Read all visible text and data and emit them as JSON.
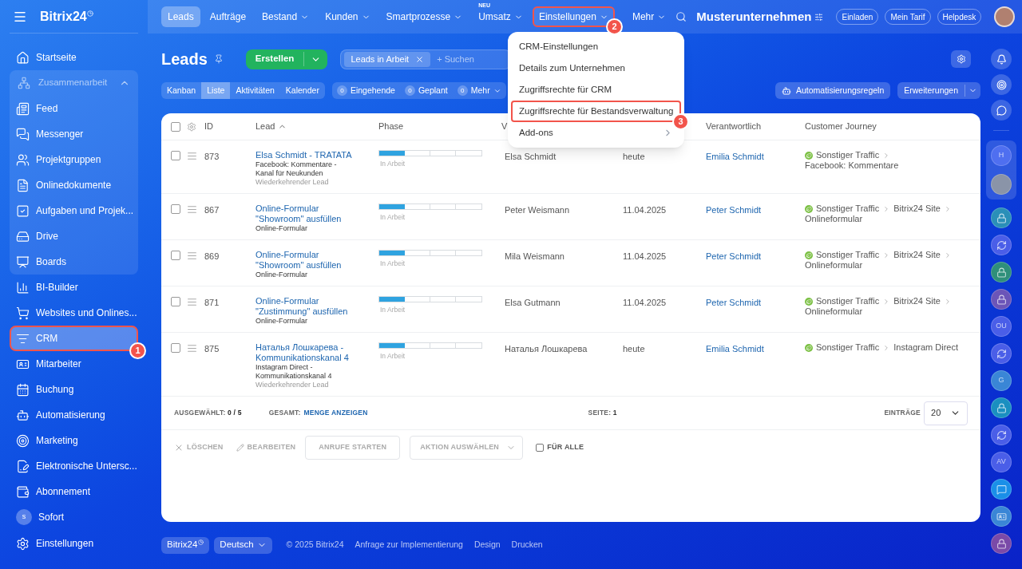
{
  "sidebar": {
    "logo": "Bitrix24",
    "items": [
      {
        "kind": "item",
        "label": "Startseite",
        "selected": false
      },
      {
        "kind": "group",
        "label": "Zusammenarbeit",
        "expanded": true,
        "children": [
          {
            "label": "Feed",
            "selected": false
          },
          {
            "label": "Messenger",
            "selected": false
          },
          {
            "label": "Projektgruppen",
            "selected": false
          },
          {
            "label": "Onlinedokumente",
            "selected": false
          },
          {
            "label": "Aufgaben und Projek...",
            "selected": false
          },
          {
            "label": "Drive",
            "selected": false
          },
          {
            "label": "Boards",
            "selected": false
          }
        ]
      },
      {
        "kind": "item",
        "label": "BI-Builder",
        "selected": false
      },
      {
        "kind": "item",
        "label": "Websites und Onlines...",
        "selected": false
      },
      {
        "kind": "item",
        "label": "CRM",
        "selected": true,
        "highlighted": true,
        "callout": "1"
      },
      {
        "kind": "item",
        "label": "Mitarbeiter",
        "selected": false
      },
      {
        "kind": "item",
        "label": "Buchung",
        "selected": false
      },
      {
        "kind": "item",
        "label": "Automatisierung",
        "selected": false
      },
      {
        "kind": "item",
        "label": "Marketing",
        "selected": false
      },
      {
        "kind": "item",
        "label": "Elektronische Untersc...",
        "selected": false
      },
      {
        "kind": "item",
        "label": "Abonnement",
        "selected": false
      },
      {
        "kind": "avatar",
        "letter": "s",
        "label": "Sofort",
        "selected": false
      }
    ],
    "footer_item": "Einstellungen"
  },
  "topnav": [
    {
      "label": "Leads",
      "selected": true,
      "dropdown": false,
      "highlighted": false
    },
    {
      "label": "Aufträge",
      "selected": false,
      "dropdown": false,
      "highlighted": false
    },
    {
      "label": "Bestand",
      "selected": false,
      "dropdown": true,
      "highlighted": false
    },
    {
      "label": "Kunden",
      "selected": false,
      "dropdown": true,
      "highlighted": false
    },
    {
      "label": "Smartprozesse",
      "selected": false,
      "dropdown": true,
      "highlighted": false
    },
    {
      "label": "Umsatz",
      "badge": "NEU",
      "selected": false,
      "dropdown": true,
      "highlighted": false
    },
    {
      "label": "Einstellungen",
      "selected": false,
      "dropdown": true,
      "highlighted": true,
      "callout": "2"
    },
    {
      "label": "Mehr",
      "selected": false,
      "dropdown": true,
      "highlighted": false
    }
  ],
  "company": "Musterunternehmen",
  "header_buttons": [
    "Einladen",
    "Mein Tarif",
    "Helpdesk"
  ],
  "page": {
    "title": "Leads",
    "create_button": "Erstellen",
    "filter_chip": "Leads in Arbeit",
    "search": {
      "placeholder": "+ Suchen"
    }
  },
  "view_tabs": [
    {
      "label": "Kanban",
      "selected": false
    },
    {
      "label": "Liste",
      "selected": true
    },
    {
      "label": "Aktivitäten",
      "selected": false
    },
    {
      "label": "Kalender",
      "selected": false
    }
  ],
  "counters": [
    {
      "count": "0",
      "label": "Eingehende",
      "dropdown": false
    },
    {
      "count": "0",
      "label": "Geplant",
      "dropdown": false
    },
    {
      "count": "0",
      "label": "Mehr",
      "dropdown": true
    }
  ],
  "toolbar_buttons": {
    "automation": "Automatisierungsregeln",
    "extensions": "Erweiterungen"
  },
  "settings_menu": [
    {
      "label": "CRM-Einstellungen",
      "highlighted": false,
      "submenu": false
    },
    {
      "label": "Details zum Unternehmen",
      "highlighted": false,
      "submenu": false
    },
    {
      "label": "Zugriffsrechte für CRM",
      "highlighted": false,
      "submenu": false
    },
    {
      "label": "Zugriffsrechte für Bestandsverwaltung",
      "highlighted": true,
      "callout": "3",
      "submenu": false
    },
    {
      "label": "Add-ons",
      "highlighted": false,
      "submenu": true
    }
  ],
  "table": {
    "select_all_checked": false,
    "columns": {
      "id": "ID",
      "lead": "Lead",
      "lead_sorted": true,
      "phase": "Phase",
      "column_4": "V",
      "responsible": "Verantwortlich",
      "journey": "Customer Journey"
    },
    "rows": [
      {
        "checked": false,
        "id": "873",
        "title": "Elsa Schmidt - TRATATA",
        "source": "Facebook: Kommentare - Kanal für Neukunden",
        "note": "Wiederkehrender Lead",
        "phase": {
          "level": 0.25,
          "label": "In Arbeit"
        },
        "contact": "Elsa Schmidt",
        "date": "heute",
        "responsible": "Emilia Schmidt",
        "journey": [
          "Sonstiger Traffic",
          "Facebook: Kommentare"
        ]
      },
      {
        "checked": false,
        "id": "867",
        "title": "Online-Formular \"Showroom\" ausfüllen",
        "source": "Online-Formular",
        "phase": {
          "level": 0.25,
          "label": "In Arbeit"
        },
        "contact": "Peter Weismann",
        "date": "11.04.2025",
        "responsible": "Peter Schmidt",
        "journey": [
          "Sonstiger Traffic",
          "Bitrix24 Site",
          "Onlineformular"
        ]
      },
      {
        "checked": false,
        "id": "869",
        "title": "Online-Formular \"Showroom\" ausfüllen",
        "source": "Online-Formular",
        "phase": {
          "level": 0.25,
          "label": "In Arbeit"
        },
        "contact": "Mila Weismann",
        "date": "11.04.2025",
        "responsible": "Peter Schmidt",
        "journey": [
          "Sonstiger Traffic",
          "Bitrix24 Site",
          "Onlineformular"
        ]
      },
      {
        "checked": false,
        "id": "871",
        "title": "Online-Formular \"Zustimmung\" ausfüllen",
        "source": "Online-Formular",
        "phase": {
          "level": 0.25,
          "label": "In Arbeit"
        },
        "contact": "Elsa Gutmann",
        "date": "11.04.2025",
        "responsible": "Peter Schmidt",
        "journey": [
          "Sonstiger Traffic",
          "Bitrix24 Site",
          "Onlineformular"
        ]
      },
      {
        "checked": false,
        "id": "875",
        "title": "Наталья Лошкарева - Kommunikationskanal 4",
        "source": "Instagram Direct - Kommunikationskanal 4",
        "note": "Wiederkehrender Lead",
        "phase": {
          "level": 0.25,
          "label": "In Arbeit"
        },
        "contact": "Наталья Лошкарева",
        "date": "heute",
        "responsible": "Emilia Schmidt",
        "journey": [
          "Sonstiger Traffic",
          "Instagram Direct"
        ]
      }
    ],
    "summary": {
      "selected_label": "AUSGEWÄHLT:",
      "selected_value": "0 / 5",
      "total_label": "GESAMT:",
      "total_link": "MENGE ANZEIGEN",
      "page_label": "SEITE:",
      "page_value": "1",
      "entries_label": "EINTRÄGE",
      "entries_value": "20"
    },
    "actions": {
      "delete": "LÖSCHEN",
      "edit": "BEARBEITEN",
      "calls": "ANRUFE STARTEN",
      "select_action": "AKTION AUSWÄHLEN",
      "for_all": {
        "label": "FÜR ALLE",
        "checked": false
      }
    }
  },
  "footer": {
    "brand": "Bitrix24",
    "language": "Deutsch",
    "copyright": "© 2025 Bitrix24",
    "links": [
      "Anfrage zur Implementierung",
      "Design",
      "Drucken"
    ]
  },
  "rail": {
    "pinned": [
      {
        "kind": "letter",
        "text": "H",
        "color": "#4f6ff0"
      },
      {
        "kind": "photo",
        "color": "#8a94a8"
      }
    ],
    "chats": [
      {
        "kind": "lock",
        "color": "#2a8fb8"
      },
      {
        "kind": "swirl",
        "color": "#4a5ee8"
      },
      {
        "kind": "lock",
        "color": "#2f8f7a"
      },
      {
        "kind": "lock",
        "color": "#6b55b8"
      },
      {
        "kind": "letter",
        "text": "OU",
        "color": "#4a5ee8"
      },
      {
        "kind": "swirl",
        "color": "#4a5ee8"
      },
      {
        "kind": "letter",
        "text": "G",
        "color": "#3a86d6"
      },
      {
        "kind": "lock",
        "color": "#1a8fc0"
      },
      {
        "kind": "swirl",
        "color": "#4a5ee8"
      },
      {
        "kind": "letter",
        "text": "AV",
        "color": "#4a5ee8"
      },
      {
        "kind": "chat",
        "color": "#1a8fe8"
      },
      {
        "kind": "card",
        "color": "#3a86d6"
      },
      {
        "kind": "lock",
        "color": "#7a4aa8"
      }
    ]
  }
}
